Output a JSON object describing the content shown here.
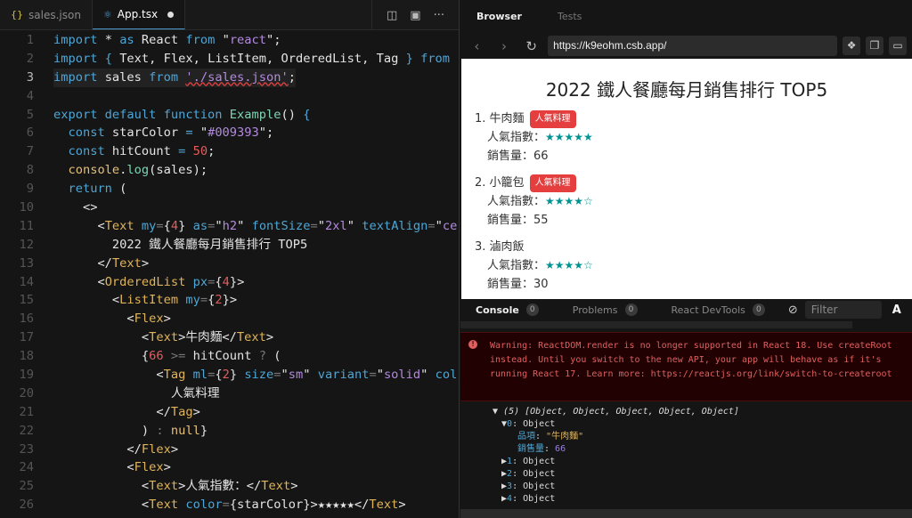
{
  "editor": {
    "tabs": [
      {
        "label": "sales.json",
        "icon": "json-braces-icon"
      },
      {
        "label": "App.tsx",
        "icon": "react-icon",
        "modified": true
      }
    ],
    "current_line": 3,
    "lines": [
      [
        [
          "k",
          "import"
        ],
        [
          "p",
          " * "
        ],
        [
          "k",
          "as"
        ],
        [
          "p",
          " React "
        ],
        [
          "k",
          "from"
        ],
        [
          "p",
          " \""
        ],
        [
          "s",
          "react"
        ],
        [
          "p",
          "\";"
        ]
      ],
      [
        [
          "k",
          "import"
        ],
        [
          "p",
          " "
        ],
        [
          "k",
          "{"
        ],
        [
          "p",
          " Text, Flex, ListItem, OrderedList, Tag "
        ],
        [
          "k",
          "}"
        ],
        [
          "p",
          " "
        ],
        [
          "k",
          "from"
        ]
      ],
      [
        [
          "k",
          "import"
        ],
        [
          "p",
          " sales "
        ],
        [
          "k",
          "from"
        ],
        [
          "p",
          " "
        ],
        [
          "s squig",
          "'./sales.json'"
        ],
        [
          "p",
          ";"
        ]
      ],
      [],
      [
        [
          "k",
          "export default function"
        ],
        [
          "p",
          " "
        ],
        [
          "f",
          "Example"
        ],
        [
          "p",
          "() "
        ],
        [
          "k",
          "{"
        ]
      ],
      [
        [
          "p",
          "  "
        ],
        [
          "k",
          "const"
        ],
        [
          "p",
          " starColor "
        ],
        [
          "k",
          "="
        ],
        [
          "p",
          " \""
        ],
        [
          "s",
          "#009393"
        ],
        [
          "p",
          "\";"
        ]
      ],
      [
        [
          "p",
          "  "
        ],
        [
          "k",
          "const"
        ],
        [
          "p",
          " hitCount "
        ],
        [
          "k",
          "="
        ],
        [
          "p",
          " "
        ],
        [
          "n",
          "50"
        ],
        [
          "p",
          ";"
        ]
      ],
      [
        [
          "p",
          "  "
        ],
        [
          "y",
          "console"
        ],
        [
          "p",
          "."
        ],
        [
          "f",
          "log"
        ],
        [
          "p",
          "(sales);"
        ]
      ],
      [
        [
          "p",
          "  "
        ],
        [
          "k",
          "return"
        ],
        [
          "p",
          " ("
        ]
      ],
      [
        [
          "p",
          "    <>"
        ]
      ],
      [
        [
          "p",
          "      <"
        ],
        [
          "t",
          "Text"
        ],
        [
          "p",
          " "
        ],
        [
          "a",
          "my"
        ],
        [
          "o",
          "="
        ],
        [
          "p",
          "{"
        ],
        [
          "n",
          "4"
        ],
        [
          "p",
          "} "
        ],
        [
          "a",
          "as"
        ],
        [
          "o",
          "="
        ],
        [
          "p",
          "\""
        ],
        [
          "s",
          "h2"
        ],
        [
          "p",
          "\" "
        ],
        [
          "a",
          "fontSize"
        ],
        [
          "o",
          "="
        ],
        [
          "p",
          "\""
        ],
        [
          "s",
          "2xl"
        ],
        [
          "p",
          "\" "
        ],
        [
          "a",
          "textAlign"
        ],
        [
          "o",
          "="
        ],
        [
          "p",
          "\""
        ],
        [
          "s",
          "ce"
        ]
      ],
      [
        [
          "p",
          "        2022 鐵人餐廳每月銷售排行 TOP5"
        ]
      ],
      [
        [
          "p",
          "      </"
        ],
        [
          "t",
          "Text"
        ],
        [
          "p",
          ">"
        ]
      ],
      [
        [
          "p",
          "      <"
        ],
        [
          "t",
          "OrderedList"
        ],
        [
          "p",
          " "
        ],
        [
          "a",
          "px"
        ],
        [
          "o",
          "="
        ],
        [
          "p",
          "{"
        ],
        [
          "n",
          "4"
        ],
        [
          "p",
          "}>"
        ]
      ],
      [
        [
          "p",
          "        <"
        ],
        [
          "t",
          "ListItem"
        ],
        [
          "p",
          " "
        ],
        [
          "a",
          "my"
        ],
        [
          "o",
          "="
        ],
        [
          "p",
          "{"
        ],
        [
          "n",
          "2"
        ],
        [
          "p",
          "}>"
        ]
      ],
      [
        [
          "p",
          "          <"
        ],
        [
          "t",
          "Flex"
        ],
        [
          "p",
          ">"
        ]
      ],
      [
        [
          "p",
          "            <"
        ],
        [
          "t",
          "Text"
        ],
        [
          "p",
          ">牛肉麵</"
        ],
        [
          "t",
          "Text"
        ],
        [
          "p",
          ">"
        ]
      ],
      [
        [
          "p",
          "            {"
        ],
        [
          "n",
          "66"
        ],
        [
          "p",
          " "
        ],
        [
          "o",
          ">="
        ],
        [
          "p",
          " hitCount "
        ],
        [
          "o",
          "?"
        ],
        [
          "p",
          " ("
        ]
      ],
      [
        [
          "p",
          "              <"
        ],
        [
          "t",
          "Tag"
        ],
        [
          "p",
          " "
        ],
        [
          "a",
          "ml"
        ],
        [
          "o",
          "="
        ],
        [
          "p",
          "{"
        ],
        [
          "n",
          "2"
        ],
        [
          "p",
          "} "
        ],
        [
          "a",
          "size"
        ],
        [
          "o",
          "="
        ],
        [
          "p",
          "\""
        ],
        [
          "s",
          "sm"
        ],
        [
          "p",
          "\" "
        ],
        [
          "a",
          "variant"
        ],
        [
          "o",
          "="
        ],
        [
          "p",
          "\""
        ],
        [
          "s",
          "solid"
        ],
        [
          "p",
          "\" "
        ],
        [
          "a",
          "col"
        ]
      ],
      [
        [
          "p",
          "                人氣料理"
        ]
      ],
      [
        [
          "p",
          "              </"
        ],
        [
          "t",
          "Tag"
        ],
        [
          "p",
          ">"
        ]
      ],
      [
        [
          "p",
          "            ) "
        ],
        [
          "o",
          ":"
        ],
        [
          "p",
          " "
        ],
        [
          "y",
          "null"
        ],
        [
          "p",
          "}"
        ]
      ],
      [
        [
          "p",
          "          </"
        ],
        [
          "t",
          "Flex"
        ],
        [
          "p",
          ">"
        ]
      ],
      [
        [
          "p",
          "          <"
        ],
        [
          "t",
          "Flex"
        ],
        [
          "p",
          ">"
        ]
      ],
      [
        [
          "p",
          "            <"
        ],
        [
          "t",
          "Text"
        ],
        [
          "p",
          ">人氣指數：</"
        ],
        [
          "t",
          "Text"
        ],
        [
          "p",
          ">"
        ]
      ],
      [
        [
          "p",
          "            <"
        ],
        [
          "t",
          "Text"
        ],
        [
          "p",
          " "
        ],
        [
          "a",
          "color"
        ],
        [
          "o",
          "="
        ],
        [
          "p",
          "{starColor}>★★★★★</"
        ],
        [
          "t",
          "Text"
        ],
        [
          "p",
          ">"
        ]
      ]
    ]
  },
  "browser": {
    "tabs": [
      "Browser",
      "Tests"
    ],
    "active_tab": "Browser",
    "url": "https://k9eohm.csb.app/",
    "page": {
      "title": "2022 鐵人餐廳每月銷售排行 TOP5",
      "star_color": "#009393",
      "tag_color": "#e53e3e",
      "items": [
        {
          "index": "1.",
          "name": "牛肉麵",
          "tag": "人氣料理",
          "rating_label": "人氣指數：",
          "stars": "★★★★★",
          "rating": 5,
          "sales_label": "銷售量：",
          "sales": "66"
        },
        {
          "index": "2.",
          "name": "小籠包",
          "tag": "人氣料理",
          "rating_label": "人氣指數：",
          "stars": "★★★★☆",
          "rating": 4,
          "sales_label": "銷售量：",
          "sales": "55"
        },
        {
          "index": "3.",
          "name": "滷肉飯",
          "tag": "",
          "rating_label": "人氣指數：",
          "stars": "★★★★☆",
          "rating": 4,
          "sales_label": "銷售量：",
          "sales": "30"
        }
      ]
    }
  },
  "console": {
    "tabs": [
      {
        "label": "Console",
        "count": "0"
      },
      {
        "label": "Problems",
        "count": "0"
      },
      {
        "label": "React DevTools",
        "count": "0"
      }
    ],
    "filter_placeholder": "Filter",
    "font_button": "A",
    "warning": "Warning: ReactDOM.render is no longer supported in React 18. Use createRoot instead. Until you switch to the new API, your app will behave as if it's running React 17. Learn more: https://reactjs.org/link/switch-to-createroot",
    "log": {
      "summary": "(5) [Object, Object, Object, Object, Object]",
      "expanded": {
        "key": "0",
        "type": "Object",
        "props": [
          {
            "key": "品項",
            "value": "\"牛肉麵\""
          },
          {
            "key": "銷售量",
            "value": "66"
          }
        ]
      },
      "collapsed": [
        {
          "key": "1",
          "type": "Object"
        },
        {
          "key": "2",
          "type": "Object"
        },
        {
          "key": "3",
          "type": "Object"
        },
        {
          "key": "4",
          "type": "Object"
        }
      ]
    }
  }
}
